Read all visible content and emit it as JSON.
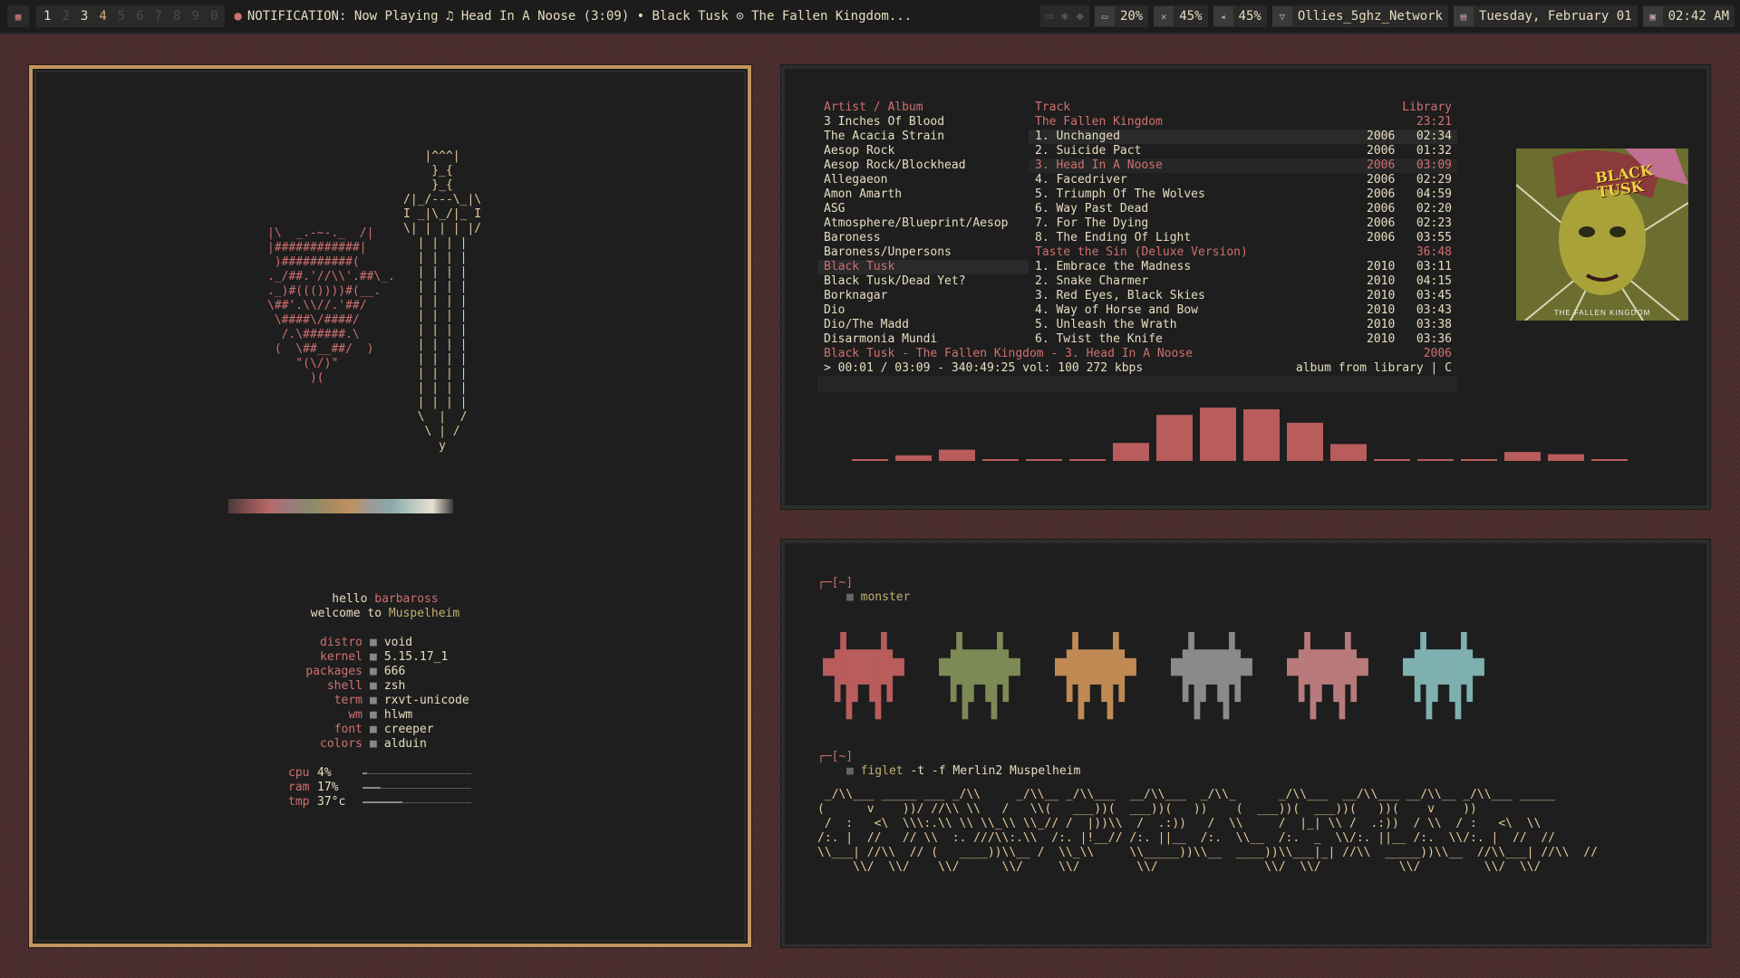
{
  "bar": {
    "launcher_icon": "menu-icon",
    "workspaces": [
      "1",
      "2",
      "3",
      "4",
      "5",
      "6",
      "7",
      "8",
      "9",
      "0"
    ],
    "notification": "NOTIFICATION: Now Playing ♫ Head In A Noose (3:09) • Black Tusk ⊙ The Fallen Kingdom...",
    "battery": "20%",
    "brightness": "45%",
    "volume": "45%",
    "network": "Ollies_5ghz_Network",
    "date": "Tuesday, February 01",
    "time": "02:42 AM"
  },
  "fetch": {
    "greeting": "hello",
    "user": "barbaross",
    "welcome": "welcome to",
    "host": "Muspelheim",
    "info": [
      {
        "k": "distro",
        "v": "void"
      },
      {
        "k": "kernel",
        "v": "5.15.17_1"
      },
      {
        "k": "packages",
        "v": "666"
      },
      {
        "k": "shell",
        "v": "zsh"
      },
      {
        "k": "term",
        "v": "rxvt-unicode"
      },
      {
        "k": "wm",
        "v": "hlwm"
      },
      {
        "k": "font",
        "v": "creeper"
      },
      {
        "k": "colors",
        "v": "alduin"
      }
    ],
    "meters": [
      {
        "k": "cpu",
        "v": "4%",
        "level": 0.04
      },
      {
        "k": "ram",
        "v": "17%",
        "level": 0.17
      },
      {
        "k": "tmp",
        "v": "37°c",
        "level": 0.37
      }
    ],
    "ascii_heart": "|\\  _.-~-._  /|\n|############|\n )##########(\n._/##.'//\\\\'.##\\_.\n._)#((())))#(__.\n\\##'.\\\\//.'##/\n \\####\\/####/\n  /.\\######.\\\n (  \\##__##/  )\n    \"(\\/)\"\n      )(",
    "ascii_sword": "   |^^^|\n    }_{\n    }_{\n/|_/---\\_|\\\nI _|\\_/|_ I\n\\| | | | |/\n  | | | |\n  | | | |\n  | | | |\n  | | | |\n  | | | |\n  | | | |\n  | | | |\n  | | | |\n  | | | |\n  | | | |\n  | | | |\n  | | | |\n  \\  |  /\n   \\ | /\n     y"
  },
  "mpd": {
    "headers": {
      "artist_album": "Artist / Album",
      "track": "Track",
      "library": "Library"
    },
    "artists": [
      "3 Inches Of Blood",
      "The Acacia Strain",
      "Aesop Rock",
      "Aesop Rock/Blockhead",
      "Allegaeon",
      "Amon Amarth",
      "ASG",
      "Atmosphere/Blueprint/Aesop",
      "Baroness",
      "Baroness/Unpersons",
      "Black Tusk",
      "Black Tusk/Dead Yet?",
      "Borknagar",
      "Dio",
      "Dio/The Madd",
      "Disarmonia Mundi"
    ],
    "selected_artist": 10,
    "albums": [
      {
        "title": "The Fallen Kingdom",
        "length": "23:21",
        "tracks": [
          {
            "n": "1. Unchanged",
            "y": "2006",
            "d": "02:34"
          },
          {
            "n": "2. Suicide Pact",
            "y": "2006",
            "d": "01:32"
          },
          {
            "n": "3. Head In A Noose",
            "y": "2006",
            "d": "03:09",
            "current": true
          },
          {
            "n": "4. Facedriver",
            "y": "2006",
            "d": "02:29"
          },
          {
            "n": "5. Triumph Of The Wolves",
            "y": "2006",
            "d": "04:59"
          },
          {
            "n": "6. Way Past Dead",
            "y": "2006",
            "d": "02:20"
          },
          {
            "n": "7. For The Dying",
            "y": "2006",
            "d": "02:23"
          },
          {
            "n": "8. The Ending Of Light",
            "y": "2006",
            "d": "03:55"
          }
        ]
      },
      {
        "title": "Taste the Sin (Deluxe Version)",
        "length": "36:48",
        "tracks": [
          {
            "n": "1. Embrace the Madness",
            "y": "2010",
            "d": "03:11"
          },
          {
            "n": "2. Snake Charmer",
            "y": "2010",
            "d": "04:15"
          },
          {
            "n": "3. Red Eyes, Black Skies",
            "y": "2010",
            "d": "03:45"
          },
          {
            "n": "4. Way of Horse and Bow",
            "y": "2010",
            "d": "03:43"
          },
          {
            "n": "5. Unleash the Wrath",
            "y": "2010",
            "d": "03:38"
          },
          {
            "n": "6. Twist the Knife",
            "y": "2010",
            "d": "03:36"
          }
        ]
      }
    ],
    "now_playing": "Black Tusk - The Fallen Kingdom - 3. Head In A Noose",
    "now_playing_year": "2006",
    "progress": "> 00:01 / 03:09 - 340:49:25 vol: 100  272 kbps",
    "mode": "album from library | C",
    "cover_text": "BLACK TUSK",
    "cover_subtitle": "THE FALLEN KINGDOM",
    "visualizer": [
      0.02,
      0.1,
      0.2,
      0.02,
      0.02,
      0.02,
      0.32,
      0.82,
      0.95,
      0.92,
      0.68,
      0.3,
      0.02,
      0.02,
      0.02,
      0.16,
      0.12,
      0.02
    ],
    "visualizer_color": "#b85c5c"
  },
  "terminal": {
    "prompt_dir": "[~]",
    "cmd1": "monster",
    "monster_colors": [
      "#b85c5c",
      "#7e8a55",
      "#c08a55",
      "#8a8a8a",
      "#b87a7a",
      "#7fb0b0"
    ],
    "cmd2": "figlet",
    "cmd2_args": "-t -f Merlin2 Muspelheim",
    "figlet": " _/\\\\___ _____ ___ _/\\\\     _/\\\\__ _/\\\\___  __/\\\\___  _/\\\\_      _/\\\\___  __/\\\\___ __/\\\\__ _/\\\\___ _____\n(      v    ))/ //\\\\ \\\\   /   \\\\(   ___))(  ___))(   ))    (  ___))(  ___))(   ))(    v    ))\n /  :   <\\  \\\\\\:.\\\\ \\\\ \\\\_\\\\ \\\\_// /  |))\\\\  /  .:))   /  \\\\     /  |_| \\\\ /  .:))  / \\\\  / :   <\\  \\\\\n/:. |  //   // \\\\  :. ///\\\\:.\\\\  /:. |!__// /:. ||__  /:.  \\\\__  /:.  _  \\\\/:. ||__ /:.  \\\\/:. |  //  //\n\\\\___| //\\\\  // (   ____))\\\\__ /  \\\\_\\\\     \\\\_____))\\\\__  ____))\\\\___|_| //\\\\  _____))\\\\__  //\\\\___| //\\\\  //\n     \\\\/  \\\\/    \\\\/      \\\\/     \\\\/        \\\\/               \\\\/  \\\\/           \\\\/         \\\\/  \\\\/"
  },
  "colors": {
    "accent": "#d07070",
    "border": "#c4955f",
    "bg": "#1e1e1e",
    "wallpaper": "#4a2c2c"
  }
}
